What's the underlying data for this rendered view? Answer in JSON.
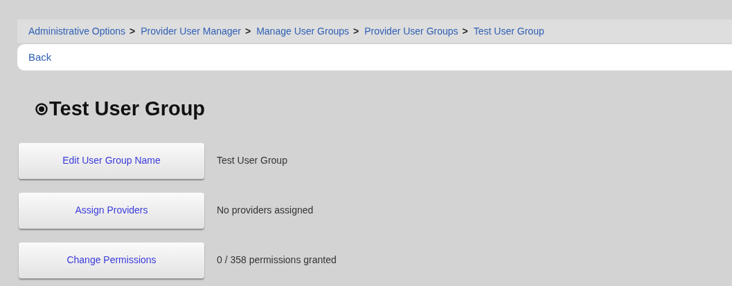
{
  "breadcrumbs": [
    {
      "label": "Administrative Options",
      "separator": ">"
    },
    {
      "label": "Provider User Manager",
      "separator": ">"
    },
    {
      "label": "Manage User Groups",
      "separator": ">"
    },
    {
      "label": "Provider User Groups",
      "separator": ">"
    },
    {
      "label": "Test User Group"
    }
  ],
  "back_link": "Back",
  "title": "Test User Group",
  "actions": [
    {
      "button": "Edit User Group Name",
      "value": "Test User Group"
    },
    {
      "button": "Assign Providers",
      "value": "No providers assigned"
    },
    {
      "button": "Change Permissions",
      "value": "0 / 358 permissions granted"
    }
  ]
}
